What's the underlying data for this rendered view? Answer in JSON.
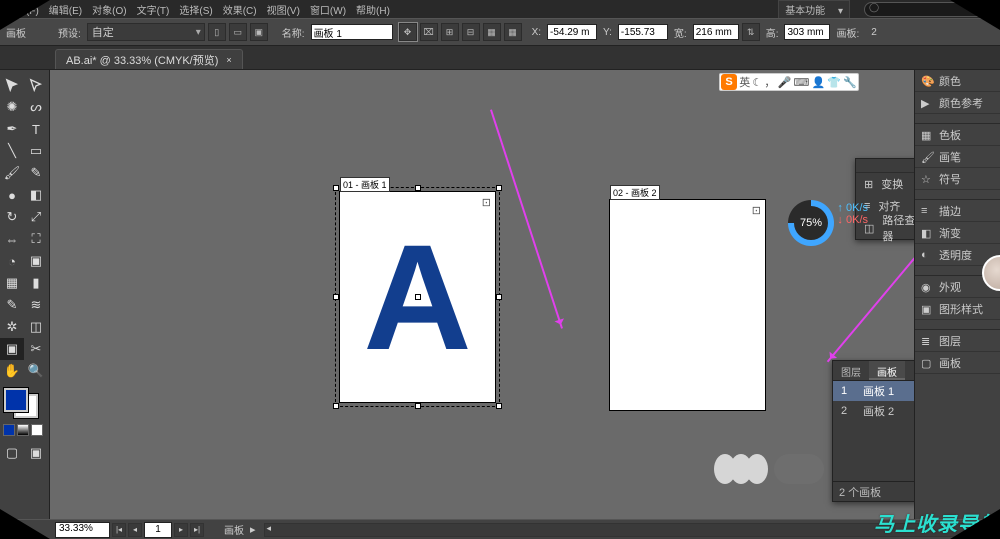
{
  "menubar": {
    "items": [
      "文件(F)",
      "编辑(E)",
      "对象(O)",
      "文字(T)",
      "选择(S)",
      "效果(C)",
      "视图(V)",
      "窗口(W)",
      "帮助(H)"
    ],
    "basic": "基本功能",
    "search_placeholder": ""
  },
  "controlbar": {
    "tool_label": "画板",
    "preset_label": "预设:",
    "preset_value": "自定",
    "name_label": "名称:",
    "name_value": "画板 1",
    "x_label": "X:",
    "x_value": "-54.29 m",
    "y_label": "Y:",
    "y_value": "-155.73",
    "w_label": "宽:",
    "w_value": "216 mm",
    "h_label": "高:",
    "h_value": "303 mm",
    "artboards_label": "画板:",
    "artboards_value": "2"
  },
  "doctab": {
    "title": "AB.ai* @ 33.33% (CMYK/预览)",
    "close": "×"
  },
  "canvas": {
    "artboard1_label": "01 - 画板 1",
    "artboard2_label": "02 - 画板 2",
    "letter": "A"
  },
  "right_panels": [
    "颜色",
    "颜色参考",
    "色板",
    "画笔",
    "符号",
    "描边",
    "渐变",
    "透明度",
    "外观",
    "图形样式",
    "图层",
    "画板"
  ],
  "transform_panel": {
    "items": [
      "变换",
      "对齐",
      "路径查找器"
    ]
  },
  "artboard_panel": {
    "tabs": [
      "图层",
      "画板"
    ],
    "rows": [
      {
        "num": "1",
        "name": "画板 1"
      },
      {
        "num": "2",
        "name": "画板 2"
      }
    ],
    "count_label": "2 个画板"
  },
  "statusbar": {
    "zoom": "33.33%",
    "nav_value": "1",
    "tool_label": "画板"
  },
  "progress": {
    "pct": "75%",
    "up": "0K/s",
    "down": "0K/s"
  },
  "ime": {
    "logo": "S",
    "lang": "英"
  },
  "watermark": "马上收录导航"
}
